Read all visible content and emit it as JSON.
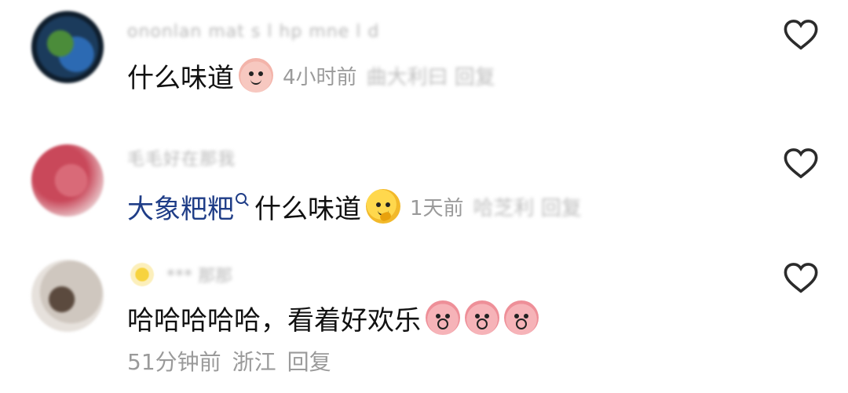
{
  "comments": [
    {
      "username": "ononlan mat s l hp mne l d",
      "text": "什么味道",
      "emoji": "smile-emoji",
      "time": "4小时前",
      "meta_blurred": "曲大利曰 回复"
    },
    {
      "username": "毛毛好在那我",
      "mention": "大象粑粑",
      "text": "什么味道",
      "emoji": "thinking-emoji",
      "time": "1天前",
      "meta_blurred": "哈芝利 回复"
    },
    {
      "username_icon": "sun-icon",
      "username": "*** 那那",
      "text": "哈哈哈哈哈，看着好欢乐",
      "emoji": "shock-emoji",
      "time": "51分钟前",
      "location": "浙江",
      "reply": "回复"
    }
  ],
  "icons": {
    "like": "heart-outline-icon"
  },
  "colors": {
    "text": "#111111",
    "meta": "#9a9a9a",
    "mention": "#1f3d87",
    "background": "#ffffff"
  }
}
